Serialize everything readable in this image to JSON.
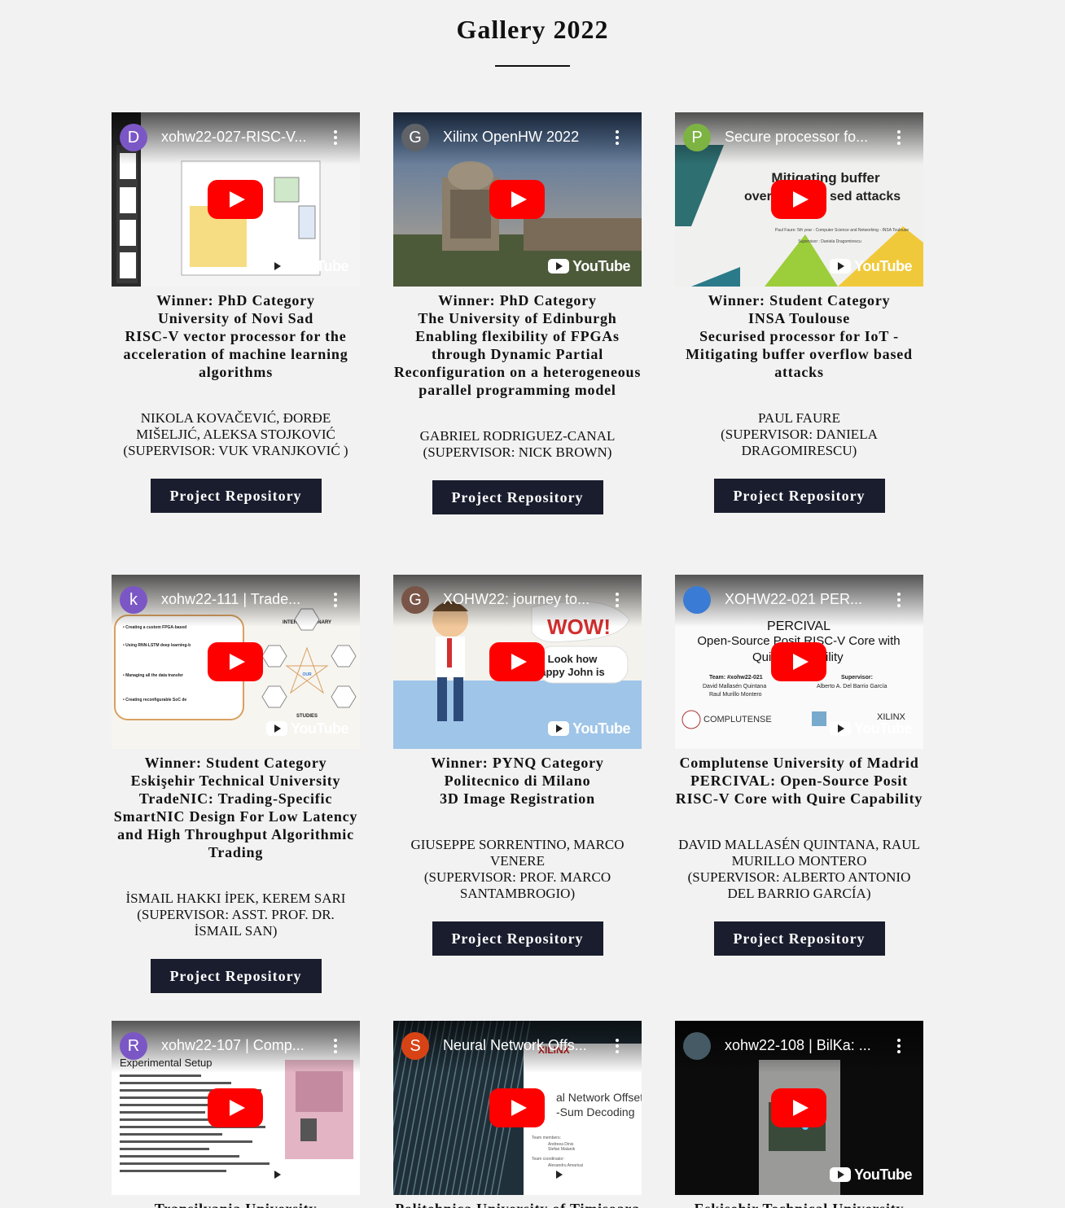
{
  "page": {
    "title": "Gallery 2022"
  },
  "cards": [
    {
      "channel": "D",
      "channel_color": "#7b57c5",
      "video_title": "xohw22-027-RISC-V...",
      "thumb": "doc",
      "heading": [
        "Winner: PhD Category",
        "University of Novi Sad",
        "RISC-V vector processor for the acceleration of machine learning algorithms"
      ],
      "authors": "Nikola Kovačević, Đorđe Mišeljić, Aleksa Stojković",
      "supervisor": "(Supervisor: Vuk Vranjković )",
      "button": "Project Repository"
    },
    {
      "channel": "G",
      "channel_color": "#5f6368",
      "video_title": "Xilinx OpenHW 2022",
      "thumb": "city",
      "heading": [
        "Winner: PhD Category",
        "The University of Edinburgh",
        "Enabling flexibility of FPGAs through Dynamic Partial Reconfiguration on a heterogeneous parallel programming model"
      ],
      "authors": "Gabriel Rodriguez-Canal",
      "supervisor": "(Supervisor: Nick Brown)",
      "button": "Project Repository"
    },
    {
      "channel": "P",
      "channel_color": "#7cb342",
      "video_title": "Secure processor fo...",
      "thumb": "slide",
      "heading": [
        "Winner: Student Category",
        "INSA Toulouse",
        "Securised processor for IoT - Mitigating buffer overflow based attacks"
      ],
      "authors": "Paul Faure",
      "supervisor": "(Supervisor: Daniela Dragomirescu)",
      "button": "Project Repository"
    },
    {
      "channel": "k",
      "channel_color": "#7b57c5",
      "video_title": "xohw22-111 | Trade...",
      "thumb": "diagram",
      "heading": [
        "Winner: Student Category",
        "Eskişehir Technical University",
        "TradeNIC: Trading-Specific SmartNIC Design For Low Latency and High Throughput Algorithmic Trading"
      ],
      "authors": "İsmail Hakkı İpek, Kerem Sarı",
      "supervisor": "(Supervisor: Asst. Prof. Dr. İsmail San)",
      "button": "Project Repository"
    },
    {
      "channel": "G",
      "channel_color": "#795548",
      "video_title": "XOHW22: journey to...",
      "thumb": "cartoon",
      "heading": [
        "Winner: PYNQ Category",
        "Politecnico di Milano",
        "3D Image Registration"
      ],
      "authors": "Giuseppe Sorrentino, Marco Venere",
      "supervisor": "(Supervisor: Prof. Marco Santambrogio)",
      "button": "Project Repository"
    },
    {
      "channel": "",
      "channel_color": "#3a7bd5",
      "video_title": "XOHW22-021 PER...",
      "thumb": "percival",
      "heading": [
        "Complutense University of Madrid",
        "PERCIVAL: Open-Source Posit RISC-V Core with Quire Capability"
      ],
      "authors": "David Mallasén Quintana, Raul Murillo Montero",
      "supervisor": "(Supervisor: Alberto Antonio del Barrio García)",
      "button": "Project Repository"
    },
    {
      "channel": "R",
      "channel_color": "#7b57c5",
      "video_title": "xohw22-107 | Comp...",
      "thumb": "board",
      "heading_partial": "Transilvania University"
    },
    {
      "channel": "S",
      "channel_color": "#d84315",
      "video_title": "Neural Network Offs...",
      "thumb": "circuit",
      "heading_partial": "Politehnica University of Timisoara"
    },
    {
      "channel": "",
      "channel_color": "#455a64",
      "video_title": "xohw22-108 | BilKa: ...",
      "thumb": "photo",
      "heading_partial": "Eskisehir Technical University"
    }
  ],
  "thumb_text": {
    "slide": [
      "Mitigating buffer",
      "over",
      "sed attacks",
      "Paul Faure: 5th year - Computer Science and Networking - INSA Toulouse",
      "Supervisor : Daniela Dragomirescu"
    ],
    "cartoon": [
      "WOW!",
      "Look how",
      "appy John is"
    ],
    "percival": [
      "PERCIVAL",
      "Open-Source Posit RISC-V Core with",
      "Qui",
      "ility",
      "Team: #xohw22-021",
      "David Mallasén Quintana",
      "Raul Murillo Montero",
      "Supervisor:",
      "Alberto A. Del Barrio García",
      "COMPLUTENSE",
      "XILINX"
    ],
    "board": [
      "Experimental Setup"
    ],
    "circuit": [
      "XILINX",
      "al Network Offset",
      "-Sum Decoding",
      "Team members:",
      "Andreea Dinis",
      "Stefan Malanik",
      "Team coordinator:",
      "Alexandru Amaricai"
    ],
    "diagram": [
      "Creating a custom FPGA-based SmartNIC like models.",
      "Using RNN-LSTM deep learning-based forecasting techniques instead of us conventional indicators or mathema methods.",
      "Managing all the data transfer throug network and creating reusable models types of financial markets.",
      "Creating reconfigurable SoC design with optimized LSTM and DENSE layer IPs.",
      "INTERDISCIPLINARY",
      "STUDIES",
      "SmartNIC",
      "HW-SW Co-Design",
      "Real-Time Trading",
      "Networking (UDP)",
      "Deep Learning (RNN-LSTM)",
      "OUR PROJECT"
    ]
  },
  "youtube": "YouTube"
}
